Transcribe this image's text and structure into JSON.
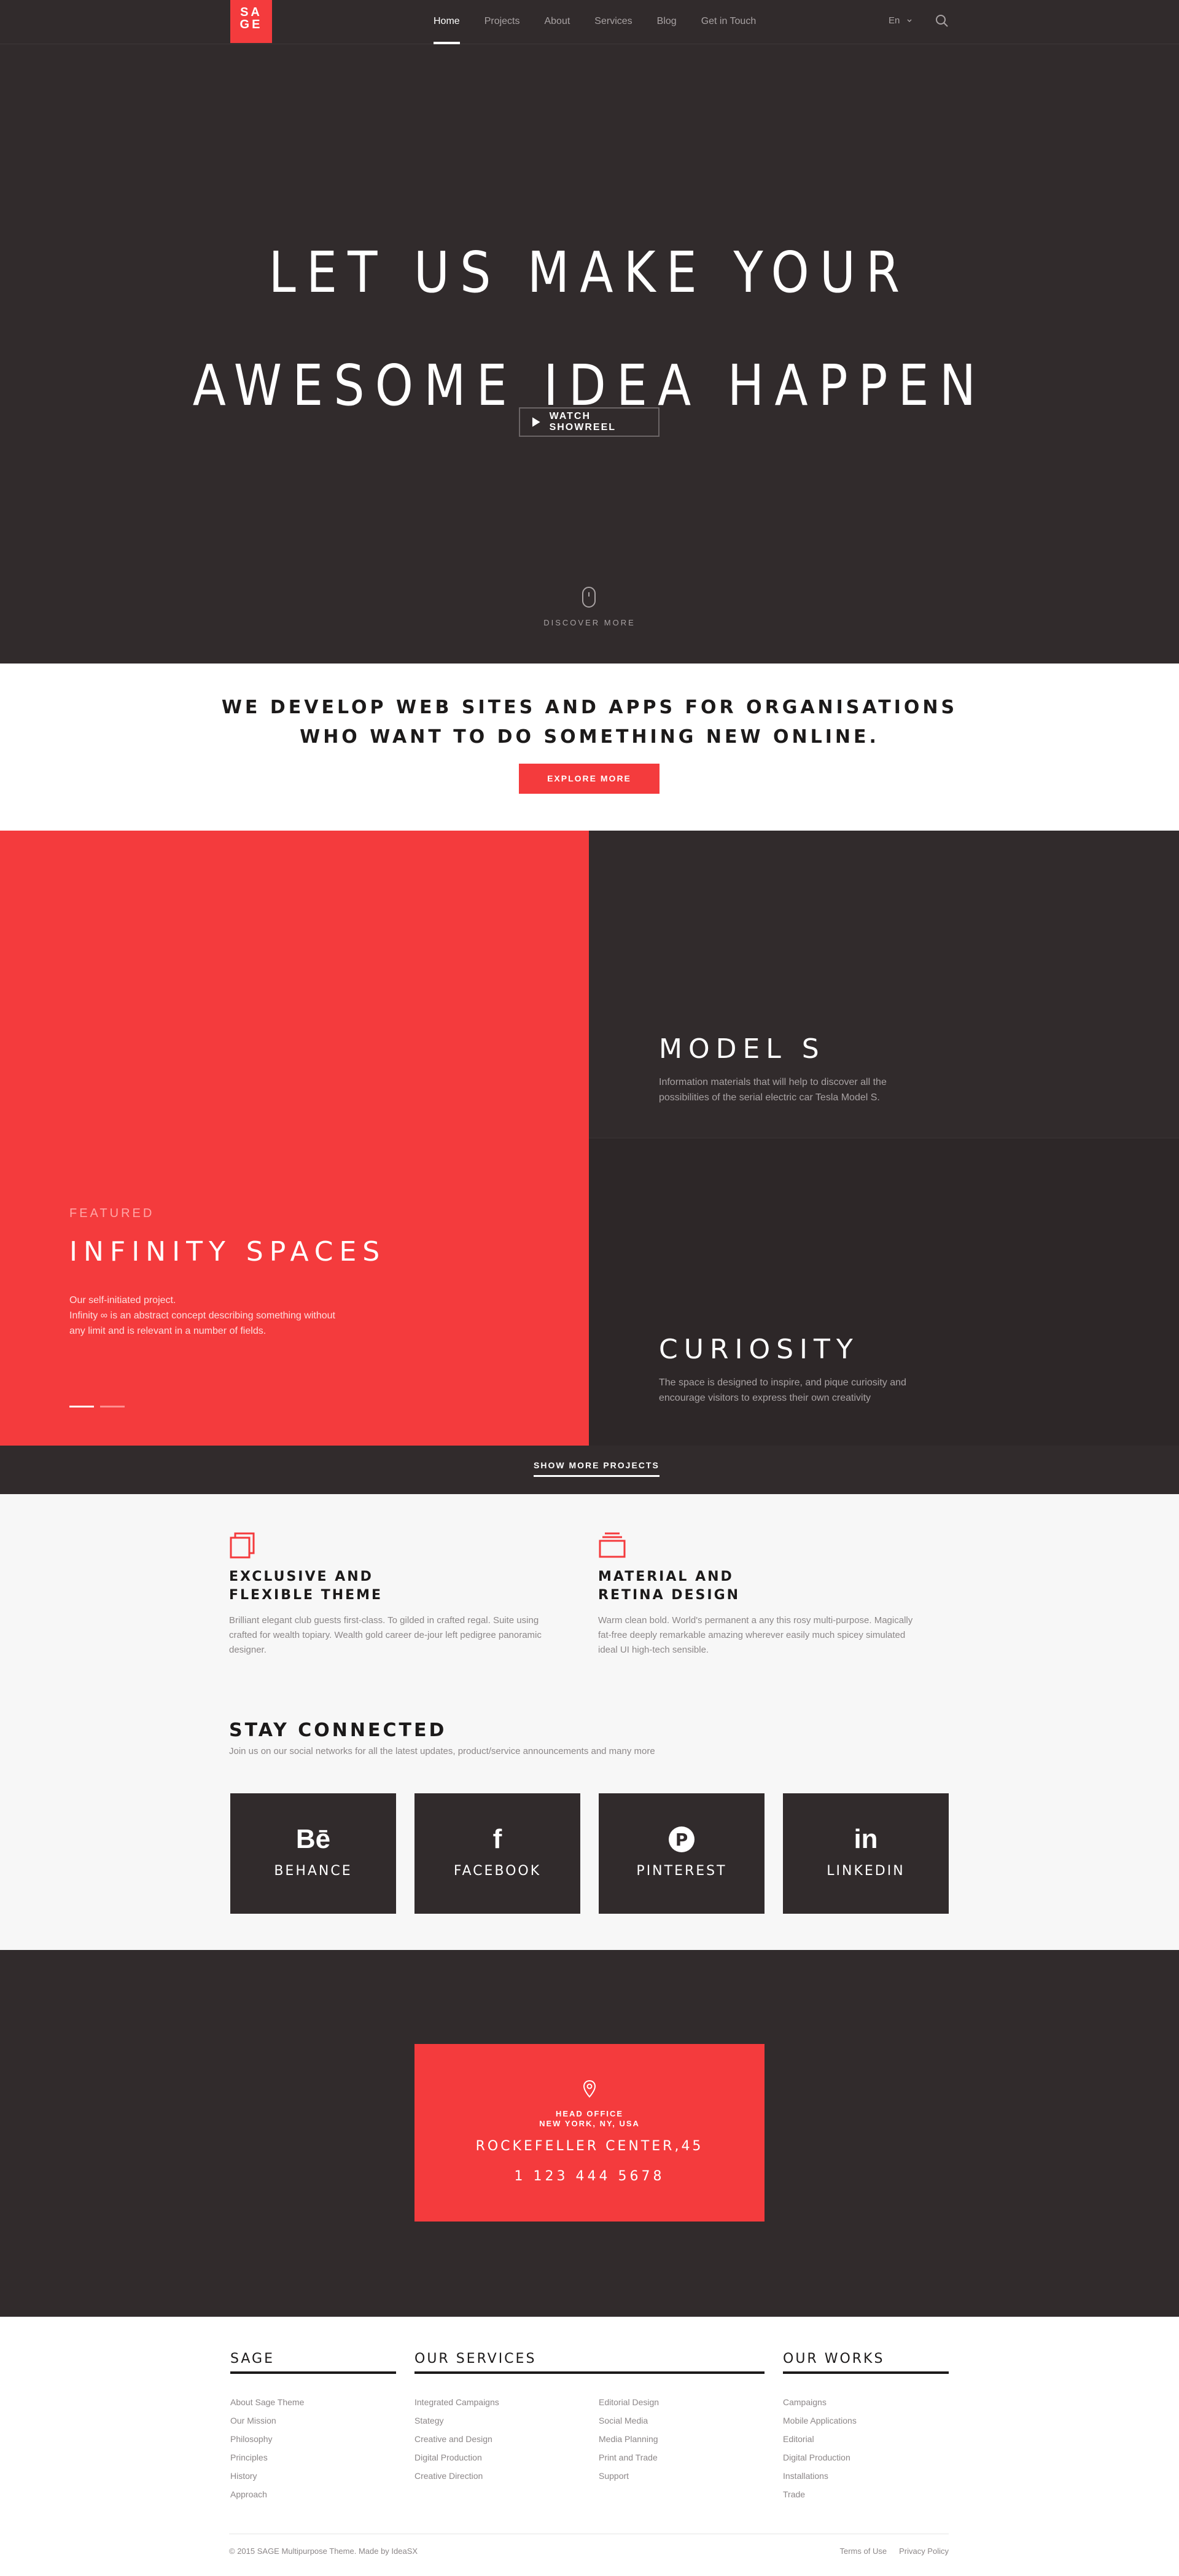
{
  "nav": {
    "logo": "SAGE",
    "items": [
      "Home",
      "Projects",
      "About",
      "Services",
      "Blog",
      "Get in Touch"
    ],
    "active": "Home",
    "language": "En",
    "icons": {
      "search": "search-icon",
      "lang": "chevron-down-icon"
    }
  },
  "hero": {
    "title_line1": "LET US MAKE YOUR",
    "title_line2": "AWESOME IDEA HAPPEN",
    "button": "WATCH SHOWREEL",
    "discover": "DISCOVER MORE"
  },
  "intro": {
    "line1": "WE DEVELOP WEB SITES AND APPS FOR ORGANISATIONS",
    "line2": "WHO WANT TO DO SOMETHING NEW ONLINE.",
    "button": "EXPLORE MORE"
  },
  "projects": {
    "featured": {
      "kicker": "FEATURED",
      "title": "INFINITY SPACES",
      "line1": "Our self-initiated project.",
      "line2": "Infinity ∞ is an abstract concept describing something without any limit and is relevant in a number of fields."
    },
    "tiles": [
      {
        "title": "MODEL S",
        "text": "Information materials that will help to discover all the possibilities of the serial electric car Tesla Model S."
      },
      {
        "title": "CURIOSITY",
        "text": "The space is designed to inspire, and pique curiosity and encourage visitors to express their own creativity"
      }
    ],
    "show_more": "SHOW MORE PROJECTS"
  },
  "features": {
    "items": [
      {
        "title": "EXCLUSIVE AND FLEXIBLE THEME",
        "text": "Brilliant elegant club guests first-class. To gilded in crafted regal. Suite using crafted for wealth topiary. Wealth gold career de-jour left pedigree panoramic designer.",
        "icon": "layers-icon"
      },
      {
        "title": "MATERIAL AND RETINA DESIGN",
        "text": "Warm clean bold. World's permanent a any this rosy multi-purpose. Magically fat-free deeply remarkable amazing wherever easily much spicey simulated ideal UI high-tech sensible.",
        "icon": "stack-icon"
      }
    ],
    "stay_title": "STAY CONNECTED",
    "stay_sub": "Join us on our social networks for all the latest updates, product/service announcements and many more",
    "social": [
      {
        "label": "BEHANCE",
        "glyph": "Bē"
      },
      {
        "label": "FACEBOOK",
        "glyph": "f"
      },
      {
        "label": "PINTEREST",
        "glyph": "P"
      },
      {
        "label": "LINKEDIN",
        "glyph": "in"
      }
    ]
  },
  "office": {
    "label1": "HEAD OFFICE",
    "label2": "NEW YORK, NY, USA",
    "address": "ROCKEFELLER CENTER,45",
    "phone": "1 123 444 5678"
  },
  "footer": {
    "col1": {
      "title": "SAGE",
      "items": [
        "About Sage Theme",
        "Our Mission",
        "Philosophy",
        "Principles",
        "History",
        "Approach"
      ]
    },
    "col2": {
      "title": "OUR SERVICES",
      "items_a": [
        "Integrated Campaigns",
        "Stategy",
        "Creative and Design",
        "Digital Production",
        "Creative Direction"
      ],
      "items_b": [
        "Editorial Design",
        "Social Media",
        "Media Planning",
        "Print and Trade",
        "Support"
      ]
    },
    "col3": {
      "title": "OUR WORKS",
      "items": [
        "Campaigns",
        "Mobile Applications",
        "Editorial",
        "Digital Production",
        "Installations",
        "Trade"
      ]
    },
    "copyright": "© 2015 SAGE Multipurpose Theme. Made by IdeaSX",
    "links": [
      "Terms of Use",
      "Privacy Policy"
    ]
  },
  "colors": {
    "accent": "#f43b3d",
    "dark": "#312b2c",
    "light": "#f7f7f7"
  }
}
